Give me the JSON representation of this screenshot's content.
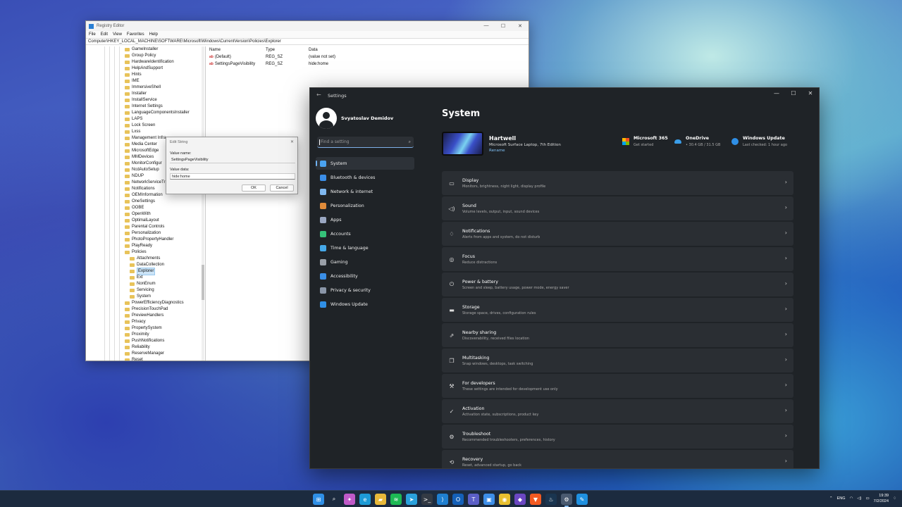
{
  "regedit": {
    "title": "Registry Editor",
    "menu": [
      "File",
      "Edit",
      "View",
      "Favorites",
      "Help"
    ],
    "address": "Computer\\HKEY_LOCAL_MACHINE\\SOFTWARE\\Microsoft\\Windows\\CurrentVersion\\Policies\\Explorer",
    "tree": [
      {
        "label": "GameInstaller",
        "level": 0
      },
      {
        "label": "Group Policy",
        "level": 0
      },
      {
        "label": "HardwareIdentification",
        "level": 0
      },
      {
        "label": "HelpAndSupport",
        "level": 0
      },
      {
        "label": "Hints",
        "level": 0
      },
      {
        "label": "IME",
        "level": 0
      },
      {
        "label": "ImmersiveShell",
        "level": 0
      },
      {
        "label": "Installer",
        "level": 0
      },
      {
        "label": "InstallService",
        "level": 0
      },
      {
        "label": "Internet Settings",
        "level": 0
      },
      {
        "label": "LanguageComponentsInstaller",
        "level": 0
      },
      {
        "label": "LAPS",
        "level": 0
      },
      {
        "label": "Lock Screen",
        "level": 0
      },
      {
        "label": "Lxss",
        "level": 0
      },
      {
        "label": "Management Infra",
        "level": 0
      },
      {
        "label": "Media Center",
        "level": 0
      },
      {
        "label": "MicrosoftEdge",
        "level": 0
      },
      {
        "label": "MMDevices",
        "level": 0
      },
      {
        "label": "MonitorConfigur",
        "level": 0
      },
      {
        "label": "NcdAutoSetup",
        "level": 0
      },
      {
        "label": "NDUP",
        "level": 0
      },
      {
        "label": "NetworkServiceTr",
        "level": 0
      },
      {
        "label": "Notifications",
        "level": 0
      },
      {
        "label": "OEMInformation",
        "level": 0
      },
      {
        "label": "OneSettings",
        "level": 0
      },
      {
        "label": "OOBE",
        "level": 0
      },
      {
        "label": "OpenWith",
        "level": 0
      },
      {
        "label": "OptimalLayout",
        "level": 0
      },
      {
        "label": "Parental Controls",
        "level": 0
      },
      {
        "label": "Personalization",
        "level": 0
      },
      {
        "label": "PhotoPropertyHandler",
        "level": 0
      },
      {
        "label": "PlayReady",
        "level": 0
      },
      {
        "label": "Policies",
        "level": 0
      },
      {
        "label": "Attachments",
        "level": 1
      },
      {
        "label": "DataCollection",
        "level": 1
      },
      {
        "label": "Explorer",
        "level": 1,
        "selected": true
      },
      {
        "label": "Ext",
        "level": 1
      },
      {
        "label": "NonEnum",
        "level": 1
      },
      {
        "label": "Servicing",
        "level": 1
      },
      {
        "label": "System",
        "level": 1
      },
      {
        "label": "PowerEfficiencyDiagnostics",
        "level": 0
      },
      {
        "label": "PrecisionTouchPad",
        "level": 0
      },
      {
        "label": "PreviewHandlers",
        "level": 0
      },
      {
        "label": "Privacy",
        "level": 0
      },
      {
        "label": "PropertySystem",
        "level": 0
      },
      {
        "label": "Proximity",
        "level": 0
      },
      {
        "label": "PushNotifications",
        "level": 0
      },
      {
        "label": "Reliability",
        "level": 0
      },
      {
        "label": "ReserveManager",
        "level": 0
      },
      {
        "label": "Reset",
        "level": 0
      }
    ],
    "columns": {
      "name": "Name",
      "type": "Type",
      "data": "Data"
    },
    "values": [
      {
        "name": "(Default)",
        "type": "REG_SZ",
        "data": "(value not set)"
      },
      {
        "name": "SettingsPageVisibility",
        "type": "REG_SZ",
        "data": "hide:home"
      }
    ]
  },
  "dialog": {
    "title": "Edit String",
    "value_name_label": "Value name:",
    "value_name": "SettingsPageVisibility",
    "value_data_label": "Value data:",
    "value_data": "hide:home",
    "ok": "OK",
    "cancel": "Cancel"
  },
  "settings": {
    "window_title": "Settings",
    "user_name": "Svyatoslav Demidov",
    "search_placeholder": "Find a setting",
    "nav": [
      {
        "label": "System",
        "icon": "monitor-icon",
        "color": "#4aa3f0",
        "active": true
      },
      {
        "label": "Bluetooth & devices",
        "icon": "bluetooth-icon",
        "color": "#3b8ee8"
      },
      {
        "label": "Network & internet",
        "icon": "wifi-icon",
        "color": "#7fb8f0"
      },
      {
        "label": "Personalization",
        "icon": "brush-icon",
        "color": "#e08b3a"
      },
      {
        "label": "Apps",
        "icon": "apps-icon",
        "color": "#9aa7c2"
      },
      {
        "label": "Accounts",
        "icon": "person-icon",
        "color": "#35c27a"
      },
      {
        "label": "Time & language",
        "icon": "globe-icon",
        "color": "#45a8e8"
      },
      {
        "label": "Gaming",
        "icon": "gamepad-icon",
        "color": "#9aa0a8"
      },
      {
        "label": "Accessibility",
        "icon": "accessibility-icon",
        "color": "#3a8ee6"
      },
      {
        "label": "Privacy & security",
        "icon": "shield-icon",
        "color": "#8a96a8"
      },
      {
        "label": "Windows Update",
        "icon": "update-icon",
        "color": "#2f8fe6"
      }
    ],
    "page_title": "System",
    "device": {
      "name": "Hartwell",
      "model": "Microsoft Surface Laptop, 7th Edition",
      "rename": "Rename"
    },
    "tiles": [
      {
        "title": "Microsoft 365",
        "sub": "Get started",
        "icon": "microsoft-365-icon"
      },
      {
        "title": "OneDrive",
        "sub": "• 30.4 GB / 31.5 GB",
        "icon": "onedrive-icon"
      },
      {
        "title": "Windows Update",
        "sub": "Last checked: 1 hour ago",
        "icon": "windows-update-icon"
      }
    ],
    "cards": [
      {
        "title": "Display",
        "sub": "Monitors, brightness, night light, display profile",
        "icon": "display-icon",
        "glyph": "▭"
      },
      {
        "title": "Sound",
        "sub": "Volume levels, output, input, sound devices",
        "icon": "speaker-icon",
        "glyph": "◁)"
      },
      {
        "title": "Notifications",
        "sub": "Alerts from apps and system, do not disturb",
        "icon": "bell-icon",
        "glyph": "♢"
      },
      {
        "title": "Focus",
        "sub": "Reduce distractions",
        "icon": "focus-icon",
        "glyph": "◎"
      },
      {
        "title": "Power & battery",
        "sub": "Screen and sleep, battery usage, power mode, energy saver",
        "icon": "power-icon",
        "glyph": "⏻"
      },
      {
        "title": "Storage",
        "sub": "Storage space, drives, configuration rules",
        "icon": "storage-icon",
        "glyph": "▬"
      },
      {
        "title": "Nearby sharing",
        "sub": "Discoverability, received files location",
        "icon": "share-icon",
        "glyph": "⇗"
      },
      {
        "title": "Multitasking",
        "sub": "Snap windows, desktops, task switching",
        "icon": "multitask-icon",
        "glyph": "❐"
      },
      {
        "title": "For developers",
        "sub": "These settings are intended for development use only",
        "icon": "developer-icon",
        "glyph": "⚒"
      },
      {
        "title": "Activation",
        "sub": "Activation state, subscriptions, product key",
        "icon": "activation-icon",
        "glyph": "✓"
      },
      {
        "title": "Troubleshoot",
        "sub": "Recommended troubleshooters, preferences, history",
        "icon": "wrench-icon",
        "glyph": "⚙"
      },
      {
        "title": "Recovery",
        "sub": "Reset, advanced startup, go back",
        "icon": "recovery-icon",
        "glyph": "⟲"
      }
    ]
  },
  "taskbar": {
    "icons": [
      {
        "name": "start-icon",
        "color": "#2f8fe6",
        "glyph": "⊞"
      },
      {
        "name": "search-icon",
        "color": "transparent",
        "glyph": "⌕"
      },
      {
        "name": "copilot-icon",
        "color": "#c05ac8",
        "glyph": "✦"
      },
      {
        "name": "edge-icon",
        "color": "#1d9bd6",
        "glyph": "e"
      },
      {
        "name": "file-explorer-icon",
        "color": "#e8b93a",
        "glyph": "▰"
      },
      {
        "name": "spotify-icon",
        "color": "#1db954",
        "glyph": "≋"
      },
      {
        "name": "telegram-icon",
        "color": "#2aa1dc",
        "glyph": "➤"
      },
      {
        "name": "terminal-icon",
        "color": "#333a44",
        "glyph": ">_"
      },
      {
        "name": "vscode-icon",
        "color": "#1f7fd0",
        "glyph": "⟩"
      },
      {
        "name": "outlook-icon",
        "color": "#1460b8",
        "glyph": "O"
      },
      {
        "name": "teams-icon",
        "color": "#5b5fc7",
        "glyph": "T"
      },
      {
        "name": "photos-icon",
        "color": "#3d8ee8",
        "glyph": "▣"
      },
      {
        "name": "chrome-icon",
        "color": "#e8c030",
        "glyph": "◉"
      },
      {
        "name": "obsidian-icon",
        "color": "#6b47c2",
        "glyph": "◆"
      },
      {
        "name": "brave-icon",
        "color": "#f25a22",
        "glyph": "▼"
      },
      {
        "name": "steam-icon",
        "color": "#1a3550",
        "glyph": "♨"
      },
      {
        "name": "settings-icon",
        "color": "#4a5a70",
        "glyph": "⚙",
        "active": true
      },
      {
        "name": "paint-icon",
        "color": "#1f90e0",
        "glyph": "✎"
      }
    ],
    "tray": {
      "lang": "ENG",
      "time": "19:39",
      "date": "7/2/2024"
    }
  }
}
